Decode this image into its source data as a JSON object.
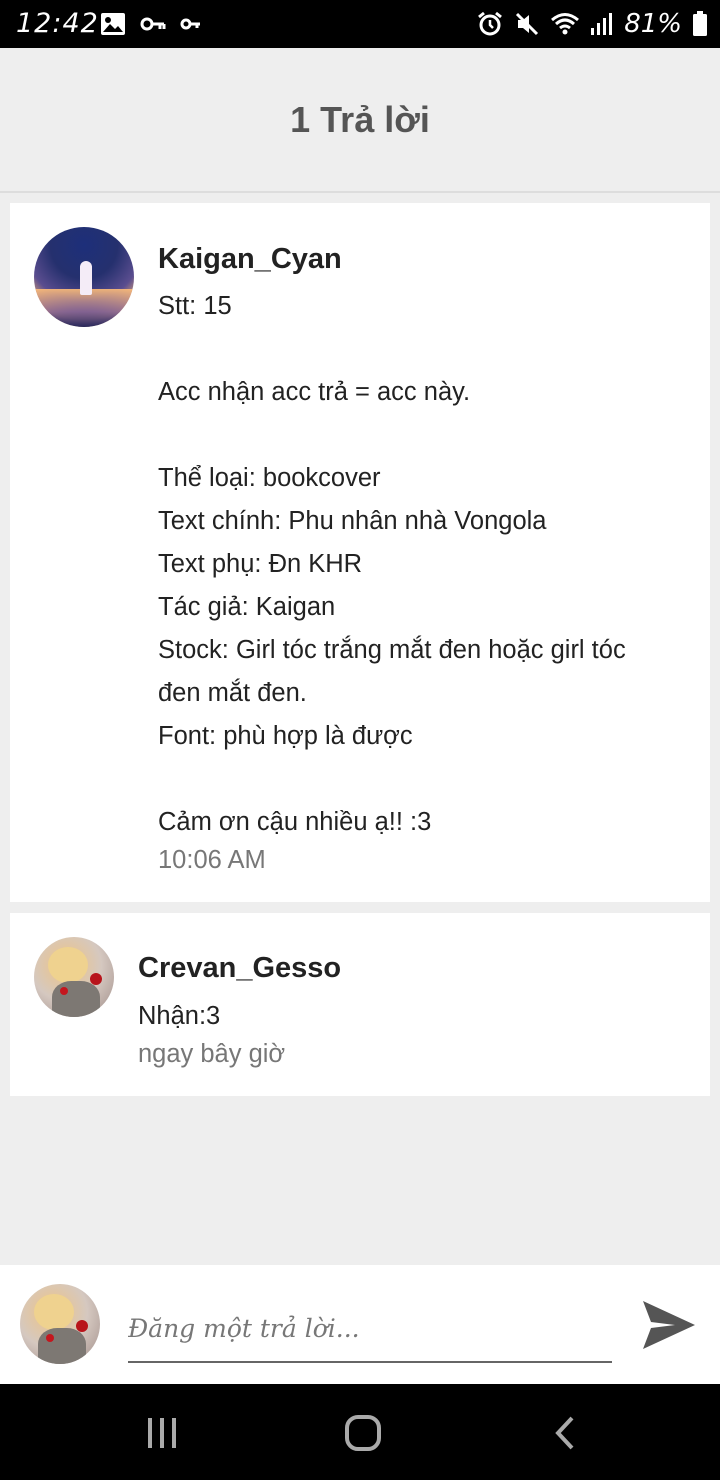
{
  "status_bar": {
    "time": "12:42",
    "battery": "81%",
    "icons": [
      "image-icon",
      "key-icon",
      "key-small-icon",
      "alarm-icon",
      "mute-icon",
      "wifi-icon",
      "signal-icon",
      "battery-icon"
    ]
  },
  "header": {
    "title": "1 Trả lời"
  },
  "post": {
    "author": "Kaigan_Cyan",
    "lines": [
      "Stt: 15",
      "",
      "Acc nhận acc trả = acc này.",
      "",
      "Thể loại: bookcover",
      "Text chính: Phu nhân nhà Vongola",
      "Text phụ: Đn KHR",
      "Tác giả: Kaigan",
      "Stock: Girl tóc trắng mắt đen hoặc girl tóc",
      "đen mắt đen.",
      "Font: phù hợp là được",
      "",
      "Cảm ơn cậu nhiều ạ!! :3"
    ],
    "time": "10:06 AM"
  },
  "reply": {
    "author": "Crevan_Gesso",
    "text": "Nhận:3",
    "time": "ngay bây giờ"
  },
  "composer": {
    "placeholder": "Đăng một trả lời...",
    "value": ""
  },
  "colors": {
    "background": "#eeeeee",
    "card": "#ffffff",
    "title": "#555555",
    "muted": "#777777",
    "send_icon": "#555555"
  },
  "navigation": {
    "buttons": [
      "recent-apps-icon",
      "home-icon",
      "back-icon"
    ]
  }
}
